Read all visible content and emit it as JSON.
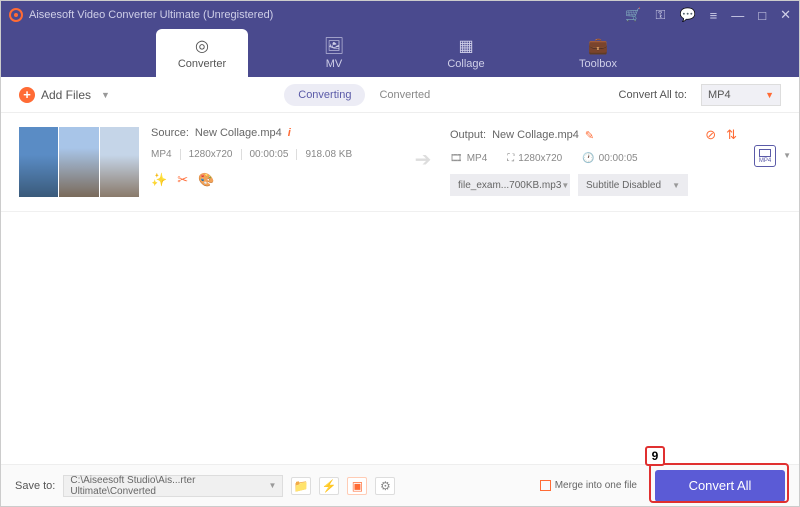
{
  "titlebar": {
    "title": "Aiseesoft Video Converter Ultimate (Unregistered)"
  },
  "tabs": [
    {
      "label": "Converter",
      "active": true
    },
    {
      "label": "MV",
      "active": false
    },
    {
      "label": "Collage",
      "active": false
    },
    {
      "label": "Toolbox",
      "active": false
    }
  ],
  "toolbar": {
    "add_files": "Add Files",
    "subtabs": {
      "converting": "Converting",
      "converted": "Converted"
    },
    "convert_all_label": "Convert All to:",
    "convert_all_format": "MP4"
  },
  "item": {
    "source": {
      "label": "Source:",
      "name": "New Collage.mp4",
      "format": "MP4",
      "resolution": "1280x720",
      "duration": "00:00:05",
      "size": "918.08 KB"
    },
    "output": {
      "label": "Output:",
      "name": "New Collage.mp4",
      "format": "MP4",
      "resolution": "1280x720",
      "duration": "00:00:05",
      "audio_select": "file_exam...700KB.mp3",
      "subtitle_select": "Subtitle Disabled",
      "format_badge": "MP4"
    }
  },
  "footer": {
    "save_to_label": "Save to:",
    "save_path": "C:\\Aiseesoft Studio\\Ais...rter Ultimate\\Converted",
    "merge_label": "Merge into one file",
    "convert_button": "Convert All"
  },
  "annotation": {
    "step": "9"
  }
}
